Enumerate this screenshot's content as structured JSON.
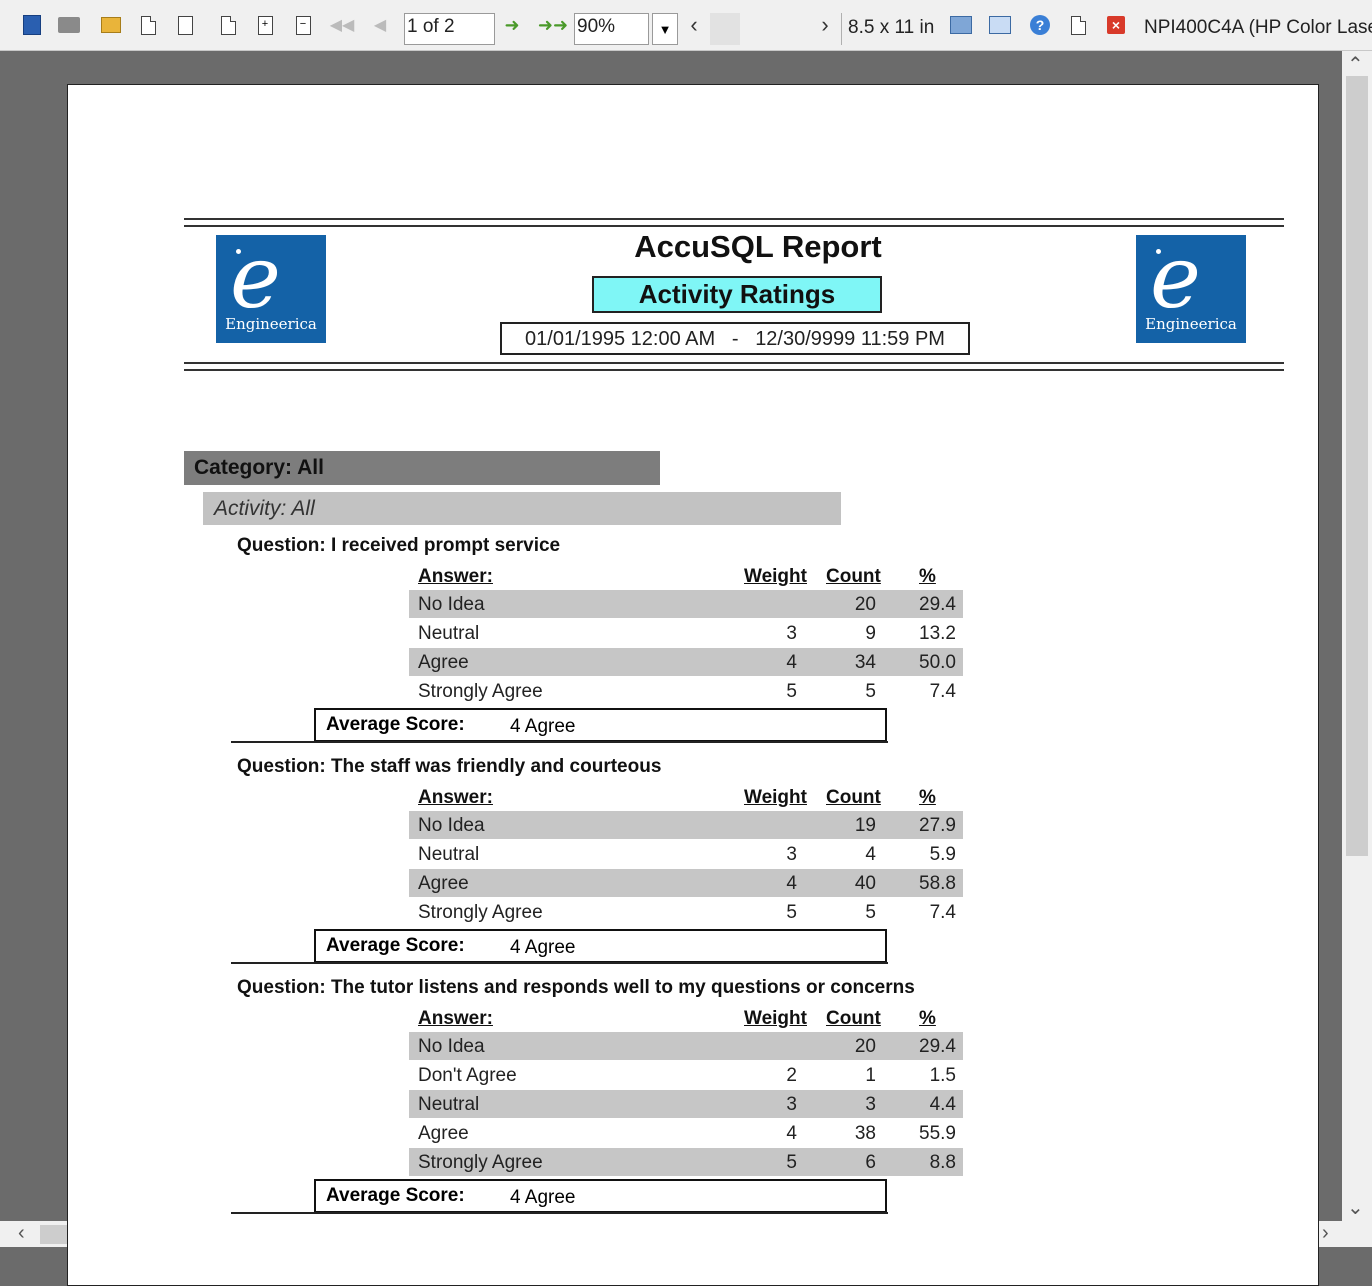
{
  "toolbar": {
    "page_indicator": "1 of 2",
    "zoom": "90%",
    "paper_size": "8.5 x 11 in",
    "printer": "NPI400C4A (HP Color Laser"
  },
  "report": {
    "title": "AccuSQL Report",
    "subtitle": "Activity Ratings",
    "date_from": "01/01/1995 12:00 AM",
    "date_to": "12/30/9999 11:59 PM",
    "logo_text": "Engineerica",
    "category": "Category: All",
    "activity": "Activity: All",
    "headers": {
      "answer": "Answer:",
      "weight": "Weight",
      "count": "Count",
      "pct": "%"
    },
    "avg_label": "Average Score:",
    "questions": [
      {
        "title": "Question: I received prompt service",
        "rows": [
          {
            "answer": "No Idea",
            "weight": "",
            "count": "20",
            "pct": "29.4"
          },
          {
            "answer": "Neutral",
            "weight": "3",
            "count": "9",
            "pct": "13.2"
          },
          {
            "answer": "Agree",
            "weight": "4",
            "count": "34",
            "pct": "50.0"
          },
          {
            "answer": "Strongly Agree",
            "weight": "5",
            "count": "5",
            "pct": "7.4"
          }
        ],
        "avg": "4  Agree"
      },
      {
        "title": "Question: The staff was friendly and courteous",
        "rows": [
          {
            "answer": "No Idea",
            "weight": "",
            "count": "19",
            "pct": "27.9"
          },
          {
            "answer": "Neutral",
            "weight": "3",
            "count": "4",
            "pct": "5.9"
          },
          {
            "answer": "Agree",
            "weight": "4",
            "count": "40",
            "pct": "58.8"
          },
          {
            "answer": "Strongly Agree",
            "weight": "5",
            "count": "5",
            "pct": "7.4"
          }
        ],
        "avg": "4  Agree"
      },
      {
        "title": "Question: The tutor listens and responds well to my questions or concerns",
        "rows": [
          {
            "answer": "No Idea",
            "weight": "",
            "count": "20",
            "pct": "29.4"
          },
          {
            "answer": "Don't Agree",
            "weight": "2",
            "count": "1",
            "pct": "1.5"
          },
          {
            "answer": "Neutral",
            "weight": "3",
            "count": "3",
            "pct": "4.4"
          },
          {
            "answer": "Agree",
            "weight": "4",
            "count": "38",
            "pct": "55.9"
          },
          {
            "answer": "Strongly Agree",
            "weight": "5",
            "count": "6",
            "pct": "8.8"
          }
        ],
        "avg": "4  Agree"
      }
    ]
  }
}
